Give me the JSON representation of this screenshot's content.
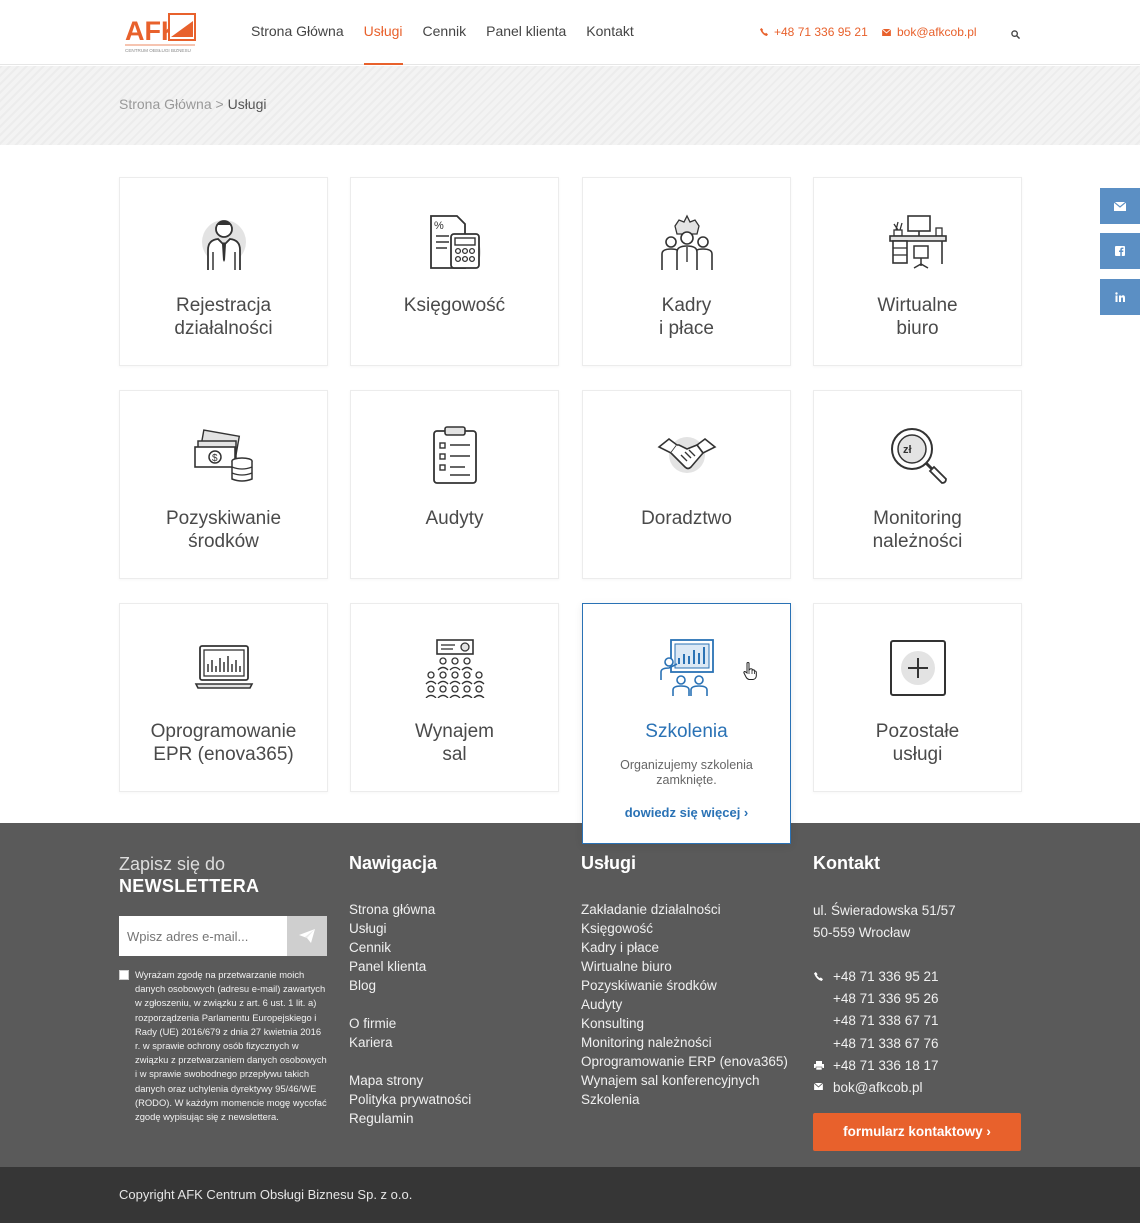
{
  "header": {
    "logo_text": "AFK",
    "logo_tagline": "CENTRUM OBSŁUGI BIZNESU",
    "nav": [
      {
        "label": "Strona Główna",
        "active": false
      },
      {
        "label": "Usługi",
        "active": true
      },
      {
        "label": "Cennik",
        "active": false
      },
      {
        "label": "Panel klienta",
        "active": false
      },
      {
        "label": "Kontakt",
        "active": false
      }
    ],
    "phone": "+48 71 336 95 21",
    "email": "bok@afkcob.pl",
    "accent": "#e8612c"
  },
  "breadcrumb": {
    "home": "Strona Główna",
    "separator": ">",
    "current": "Usługi"
  },
  "tiles": [
    {
      "title_1": "Rejestracja",
      "title_2": "działalności",
      "icon": "businessman-icon"
    },
    {
      "title_1": "Księgowość",
      "title_2": "",
      "icon": "calculator-icon"
    },
    {
      "title_1": "Kadry",
      "title_2": "i płace",
      "icon": "team-icon"
    },
    {
      "title_1": "Wirtualne",
      "title_2": "biuro",
      "icon": "desk-icon"
    },
    {
      "title_1": "Pozyskiwanie",
      "title_2": "środków",
      "icon": "money-icon"
    },
    {
      "title_1": "Audyty",
      "title_2": "",
      "icon": "clipboard-icon"
    },
    {
      "title_1": "Doradztwo",
      "title_2": "",
      "icon": "handshake-icon"
    },
    {
      "title_1": "Monitoring",
      "title_2": "należności",
      "icon": "magnifier-icon"
    },
    {
      "title_1": "Oprogramowanie",
      "title_2": "EPR (enova365)",
      "icon": "laptop-icon"
    },
    {
      "title_1": "Wynajem",
      "title_2": "sal",
      "icon": "audience-icon"
    },
    {
      "title_1": "Szkolenia",
      "title_2": "",
      "icon": "presentation-icon",
      "desc": "Organizujemy szkolenia zamknięte.",
      "more": "dowiedz się więcej ›"
    },
    {
      "title_1": "Pozostałe",
      "title_2": "usługi",
      "icon": "plus-icon"
    }
  ],
  "footer": {
    "newsletter": {
      "title_light": "Zapisz się do",
      "title_bold": "NEWSLETTERA",
      "placeholder": "Wpisz adres e-mail...",
      "consent": "Wyrażam zgodę na przetwarzanie moich danych osobowych (adresu e-mail) zawartych w zgłoszeniu, w związku z art. 6 ust. 1 lit. a) rozporządzenia Parlamentu Europejskiego i Rady (UE) 2016/679 z dnia 27 kwietnia 2016 r. w sprawie ochrony osób fizycznych w związku z przetwarzaniem danych osobowych i w sprawie swobodnego przepływu takich danych oraz uchylenia dyrektywy 95/46/WE (RODO). W każdym momencie mogę wycofać zgodę wypisując się z newslettera."
    },
    "nav_title": "Nawigacja",
    "nav_items": [
      "Strona główna",
      "Usługi",
      "Cennik",
      "Panel klienta",
      "Blog",
      "O firmie",
      "Kariera",
      "Mapa strony",
      "Polityka prywatności",
      "Regulamin"
    ],
    "services_title": "Usługi",
    "services_items": [
      "Zakładanie działalności",
      "Księgowość",
      "Kadry i płace",
      "Wirtualne biuro",
      "Pozyskiwanie środków",
      "Audyty",
      "Konsulting",
      "Monitoring należności",
      "Oprogramowanie ERP (enova365)",
      "Wynajem sal konferencyjnych",
      "Szkolenia"
    ],
    "contact_title": "Kontakt",
    "address_1": "ul. Świeradowska 51/57",
    "address_2": "50-559 Wrocław",
    "phones": [
      "+48 71 336 95 21",
      "+48 71 336 95 26",
      "+48 71 338 67 71",
      "+48 71 338 67 76"
    ],
    "fax": "+48 71 336 18 17",
    "email": "bok@afkcob.pl",
    "contact_button": "formularz kontaktowy ›"
  },
  "copyright": "Copyright AFK Centrum Obsługi Biznesu Sp. z o.o."
}
